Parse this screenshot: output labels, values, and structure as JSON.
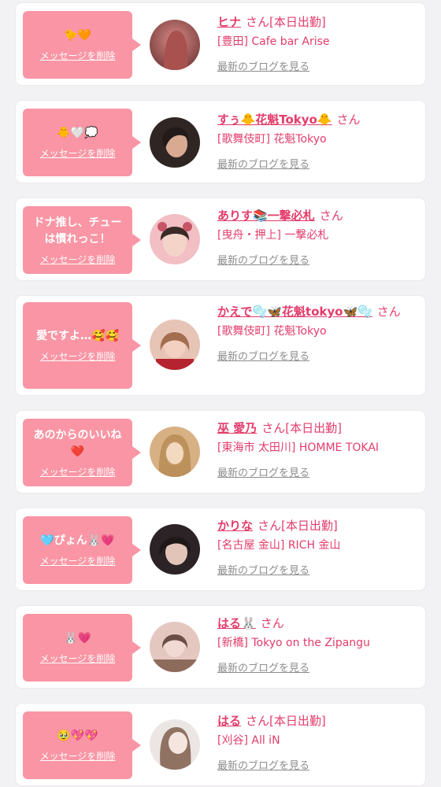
{
  "items": [
    {
      "message_line1": "🐤🧡",
      "message_line2": "",
      "delete_label": "メッセージを削除",
      "name": "ヒナ",
      "san": "さん",
      "badge": "[本日出勤]",
      "shop": "[豊田] Cafe bar Arise",
      "blog_link": "最新のブログを見る",
      "avatar_colors": [
        "#c7706f",
        "#7a3b3a"
      ]
    },
    {
      "message_line1": "🐥🤍💭",
      "message_line2": "",
      "delete_label": "メッセージを削除",
      "name": "すぅ🐥花魁Tokyo🐥",
      "san": "さん",
      "badge": "",
      "shop": "[歌舞伎町] 花魁Tokyo",
      "blog_link": "最新のブログを見る",
      "avatar_colors": [
        "#3a2e2c",
        "#c49b86"
      ]
    },
    {
      "message_line1": "ドナ推し、チュー",
      "message_line2": "は慣れっこ！",
      "delete_label": "メッセージを削除",
      "name": "ありす📚一撃必札",
      "san": "さん",
      "badge": "",
      "shop": "[曳舟・押上] 一撃必札",
      "blog_link": "最新のブログを見る",
      "avatar_colors": [
        "#f3c2c6",
        "#b65b66"
      ]
    },
    {
      "message_line1": "愛ですよ…🥰🥰",
      "message_line2": "",
      "delete_label": "メッセージを削除",
      "name": "かえで🫧🦋花魁tokyo🦋🫧",
      "san": "さん",
      "badge": "",
      "shop": "[歌舞伎町] 花魁Tokyo",
      "blog_link": "最新のブログを見る",
      "avatar_colors": [
        "#e9b197",
        "#b0212e"
      ]
    },
    {
      "message_line1": "あのからのいいね",
      "message_line2": "❤️",
      "delete_label": "メッセージを削除",
      "name": "巫 愛乃",
      "san": "さん",
      "badge": "[本日出勤]",
      "shop": "[東海市 太田川] HOMME TOKAI",
      "blog_link": "最新のブログを見る",
      "avatar_colors": [
        "#d9b684",
        "#6b4f2e"
      ]
    },
    {
      "message_line1": "🩵ぴょん🐰💗",
      "message_line2": "",
      "delete_label": "メッセージを削除",
      "name": "かりな",
      "san": "さん",
      "badge": "[本日出勤]",
      "shop": "[名古屋 金山] RICH 金山",
      "blog_link": "最新のブログを見る",
      "avatar_colors": [
        "#2a2224",
        "#d8b9ad"
      ]
    },
    {
      "message_line1": "🐰💗",
      "message_line2": "",
      "delete_label": "メッセージを削除",
      "name": "はる🐰",
      "san": "さん",
      "badge": "",
      "shop": "[新橋] Tokyo on the Zipangu",
      "blog_link": "最新のブログを見る",
      "avatar_colors": [
        "#e6c9c0",
        "#7c5a4e"
      ]
    },
    {
      "message_line1": "🥹💖💖",
      "message_line2": "",
      "delete_label": "メッセージを削除",
      "name": "はる",
      "san": "さん",
      "badge": "[本日出勤]",
      "shop": "[刈谷] All iN",
      "blog_link": "最新のブログを見る",
      "avatar_colors": [
        "#e7e2df",
        "#8b6f5e"
      ]
    }
  ]
}
